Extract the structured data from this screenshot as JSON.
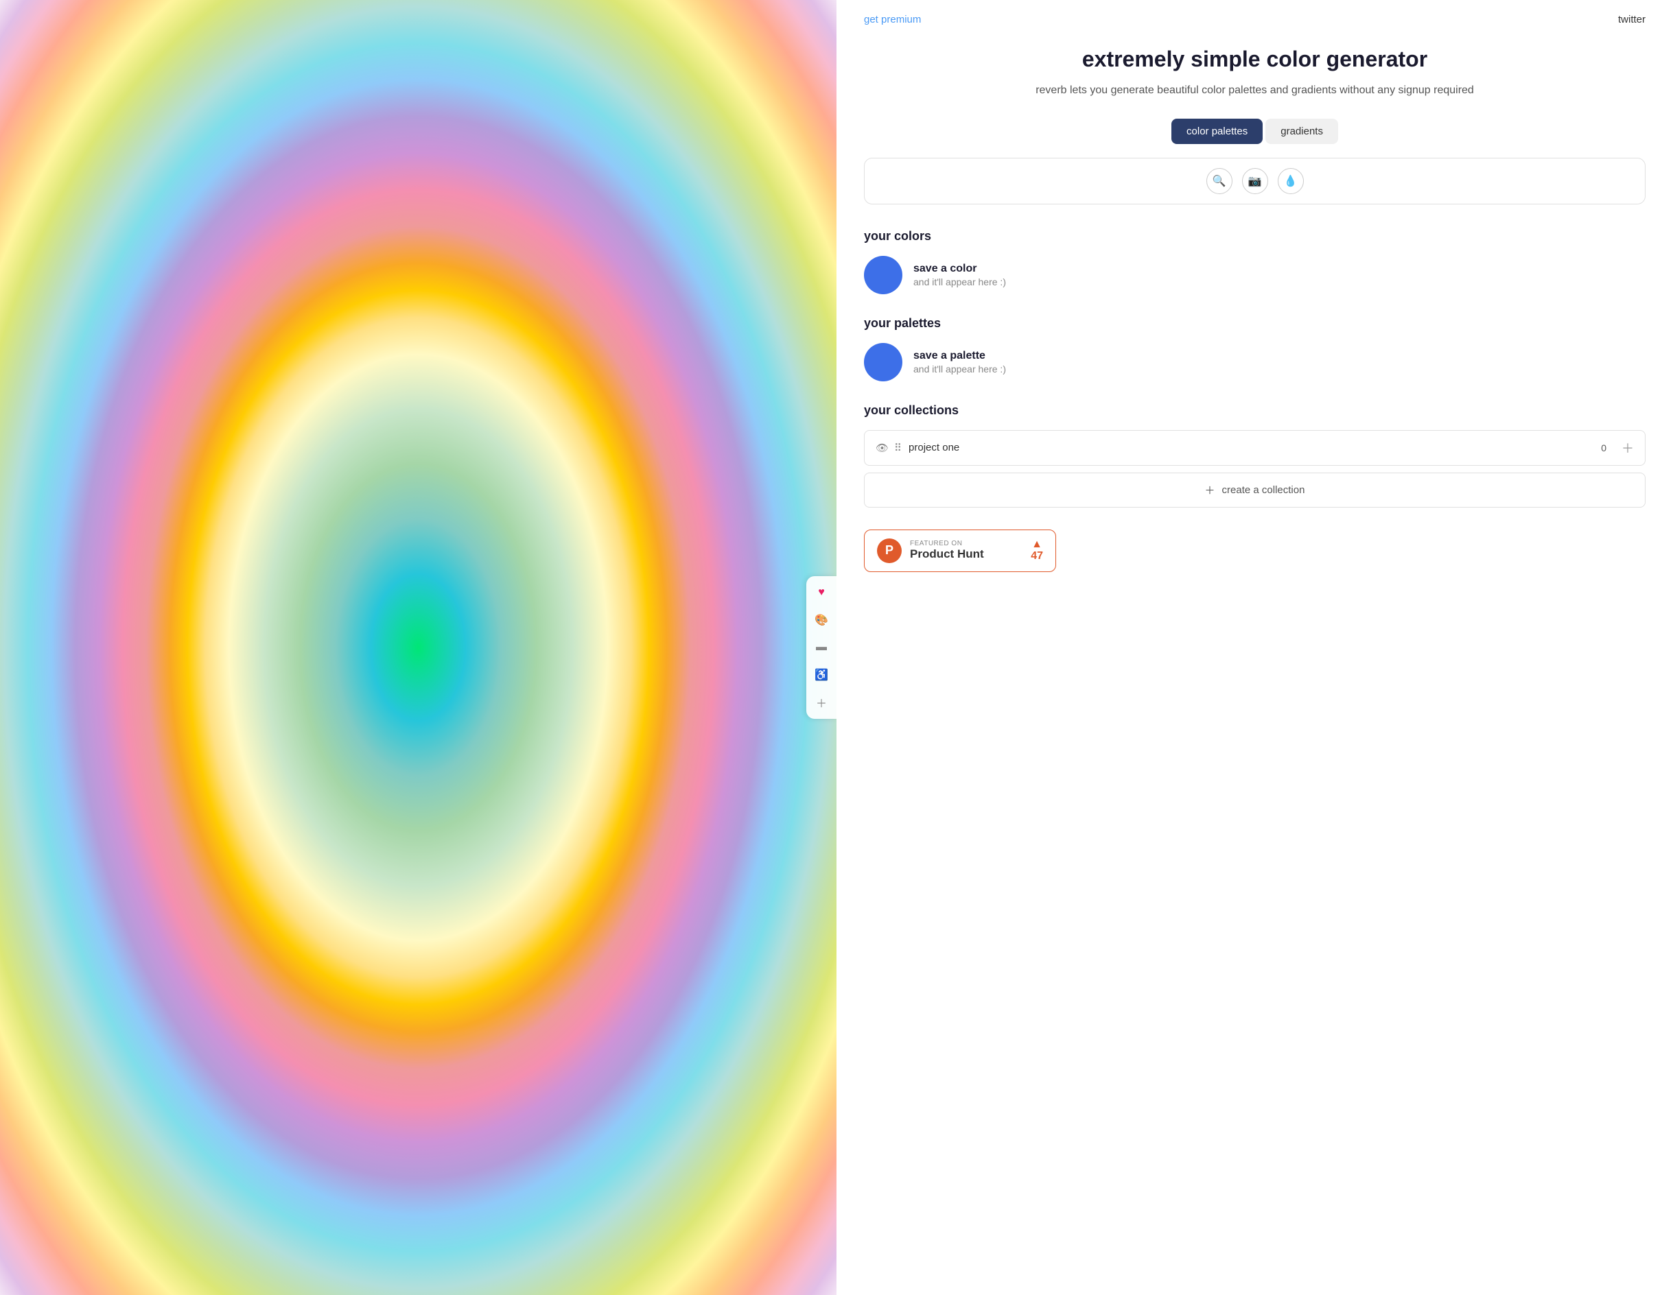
{
  "nav": {
    "get_premium": "get premium",
    "twitter": "twitter"
  },
  "hero": {
    "title": "extremely simple color generator",
    "subtitle": "reverb lets you generate beautiful color palettes and\ngradients without any signup required"
  },
  "tabs": [
    {
      "id": "color-palettes",
      "label": "color palettes",
      "active": true
    },
    {
      "id": "gradients",
      "label": "gradients",
      "active": false
    }
  ],
  "search_bar": {
    "icons": [
      "search",
      "camera",
      "dropper"
    ]
  },
  "your_colors": {
    "section_title": "your colors",
    "placeholder_title": "save a color",
    "placeholder_sub": "and it'll appear here :)"
  },
  "your_palettes": {
    "section_title": "your palettes",
    "placeholder_title": "save a palette",
    "placeholder_sub": "and it'll appear here :)"
  },
  "your_collections": {
    "section_title": "your collections",
    "items": [
      {
        "name": "project one",
        "count": "0"
      }
    ],
    "create_label": "create a collection"
  },
  "product_hunt": {
    "featured_on": "FEATURED ON",
    "name": "Product Hunt",
    "count": "47"
  },
  "toolbar": {
    "icons": [
      "heart",
      "palette",
      "bookmark",
      "accessibility",
      "plus"
    ]
  }
}
